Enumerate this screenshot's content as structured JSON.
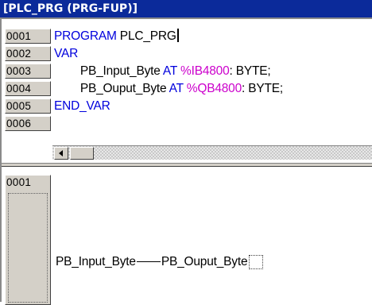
{
  "window": {
    "title": "[PLC_PRG (PRG-FUP)]"
  },
  "declaration": {
    "lines": [
      {
        "num": "0001",
        "parts": [
          {
            "t": "PROGRAM",
            "c": "kw"
          },
          {
            "t": " PLC_PRG",
            "c": "txt"
          }
        ]
      },
      {
        "num": "0002",
        "parts": [
          {
            "t": "VAR",
            "c": "kw"
          }
        ]
      },
      {
        "num": "0003",
        "parts": [
          {
            "t": "        PB_Input_Byte ",
            "c": "txt"
          },
          {
            "t": "AT",
            "c": "kw"
          },
          {
            "t": " %IB4800",
            "c": "addr"
          },
          {
            "t": ": BYTE;",
            "c": "txt"
          }
        ]
      },
      {
        "num": "0004",
        "parts": [
          {
            "t": "        PB_Ouput_Byte ",
            "c": "txt"
          },
          {
            "t": "AT",
            "c": "kw"
          },
          {
            "t": " %QB4800",
            "c": "addr"
          },
          {
            "t": ": BYTE;",
            "c": "txt"
          }
        ]
      },
      {
        "num": "0005",
        "parts": [
          {
            "t": "END_VAR",
            "c": "kw"
          }
        ]
      },
      {
        "num": "0006",
        "parts": []
      }
    ]
  },
  "network": {
    "number": "0001",
    "input": "PB_Input_Byte",
    "output": "PB_Ouput_Byte"
  },
  "colors": {
    "title_bar": "#0b2a9a",
    "keyword": "#0000dd",
    "address": "#cc00cc"
  }
}
